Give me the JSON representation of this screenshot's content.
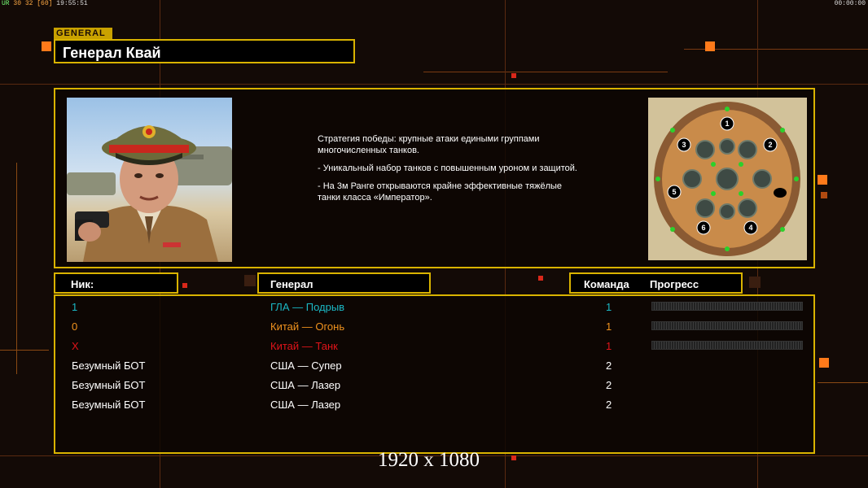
{
  "hud": {
    "left_green": "UR",
    "left_values": "30 32",
    "left_fps": "[60]",
    "clock": "19:55:51",
    "right_timer": "00:00:00"
  },
  "general": {
    "tag": "GENERAL",
    "name": "Генерал Квай"
  },
  "strategy": [
    "Стратегия победы: крупные атаки едиными группами многочисленных танков.",
    "- Уникальный набор танков с повышенным уроном и защитой.",
    "- На 3м Ранге открываются крайне эффективные тяжёлые танки класса «Император»."
  ],
  "map": {
    "spawn_labels": [
      "1",
      "2",
      "3",
      "4",
      "5",
      "6"
    ]
  },
  "table": {
    "headers": {
      "nick": "Ник:",
      "general": "Генерал",
      "team": "Команда",
      "progress": "Прогресс"
    },
    "rows": [
      {
        "nick": "1",
        "general": "ГЛА — Подрыв",
        "team": "1",
        "color": "#1bb8c4",
        "progress": 0
      },
      {
        "nick": "0",
        "general": "Китай — Огонь",
        "team": "1",
        "color": "#f0921e",
        "progress": 0
      },
      {
        "nick": "X",
        "general": "Китай — Танк",
        "team": "1",
        "color": "#e0141a",
        "progress": 0
      },
      {
        "nick": "Безумный БОТ",
        "general": "США — Супер",
        "team": "2",
        "color": "#ffffff",
        "progress": null
      },
      {
        "nick": "Безумный БОТ",
        "general": "США — Лазер",
        "team": "2",
        "color": "#ffffff",
        "progress": null
      },
      {
        "nick": "Безумный БОТ",
        "general": "США — Лазер",
        "team": "2",
        "color": "#ffffff",
        "progress": null
      }
    ]
  },
  "resolution": "1920 x 1080",
  "colors": {
    "accent_gold": "#d9b300",
    "accent_orange": "#ff7a1a",
    "background": "#130a06"
  }
}
